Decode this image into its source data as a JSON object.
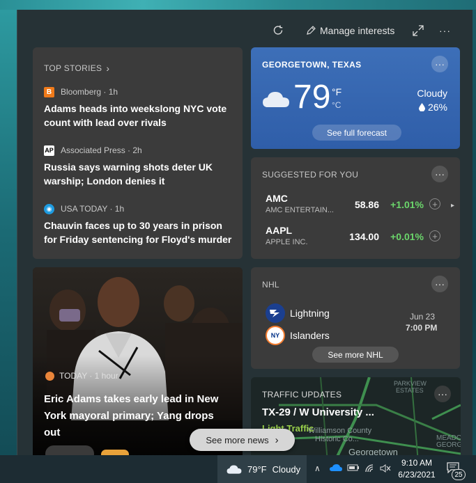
{
  "toolbar": {
    "refresh_icon": "refresh-icon",
    "manage_label": "Manage interests",
    "expand_icon": "expand-icon",
    "more_icon": "more-icon",
    "more_glyph": "···"
  },
  "top_stories": {
    "title": "TOP STORIES",
    "chevron": "›",
    "items": [
      {
        "source_glyph": "B",
        "source": "Bloomberg · 1h",
        "headline": "Adams heads into weekslong NYC vote count with lead over rivals",
        "source_color": "#f07a1a"
      },
      {
        "source_glyph": "AP",
        "source": "Associated Press · 2h",
        "headline": "Russia says warning shots deter UK warship; London denies it",
        "source_color": "#ffffff"
      },
      {
        "source_glyph": "◉",
        "source": "USA TODAY · 1h",
        "headline": "Chauvin faces up to 30 years in prison for Friday sentencing for Floyd's murder",
        "source_color": "#1e9be0"
      }
    ]
  },
  "weather": {
    "location": "GEORGETOWN, TEXAS",
    "more_glyph": "···",
    "temp": "79",
    "unit_f": "°F",
    "unit_c": "°C",
    "condition": "Cloudy",
    "precip": "26%",
    "forecast_label": "See full forecast"
  },
  "stocks": {
    "title": "SUGGESTED FOR YOU",
    "more_glyph": "···",
    "next_glyph": "▸",
    "items": [
      {
        "symbol": "AMC",
        "name": "AMC ENTERTAIN...",
        "price": "58.86",
        "change": "+1.01%"
      },
      {
        "symbol": "AAPL",
        "name": "APPLE INC.",
        "price": "134.00",
        "change": "+0.01%"
      }
    ],
    "add_glyph": "+"
  },
  "nhl": {
    "title": "NHL",
    "more_glyph": "···",
    "team1": "Lightning",
    "team2": "Islanders",
    "team2_glyph": "NY",
    "date": "Jun 23",
    "time": "7:00 PM",
    "more_label": "See more NHL"
  },
  "feature_story": {
    "source": "TODAY · 1 hour",
    "headline": "Eric Adams takes early lead in New York mayoral primary; Yang drops out"
  },
  "traffic": {
    "title": "TRAFFIC UPDATES",
    "more_glyph": "···",
    "route": "TX-29 / W University ...",
    "status": "Light Traffic",
    "map_labels": [
      "PARKVIEW",
      "ESTATES",
      "Georgetown",
      "Williamson County",
      "Historic Co...",
      "MEADO",
      "GEORG"
    ]
  },
  "see_more": {
    "label": "See more news",
    "chevron": "›"
  },
  "taskbar": {
    "weather_temp": "79°F",
    "weather_cond": "Cloudy",
    "time": "9:10 AM",
    "date": "6/23/2021",
    "notif_count": "25",
    "up_glyph": "∧"
  },
  "colors": {
    "accent_green": "#6bd66b",
    "weather_blue": "#3d6fb8",
    "traffic_yellow": "#9ad14b"
  }
}
